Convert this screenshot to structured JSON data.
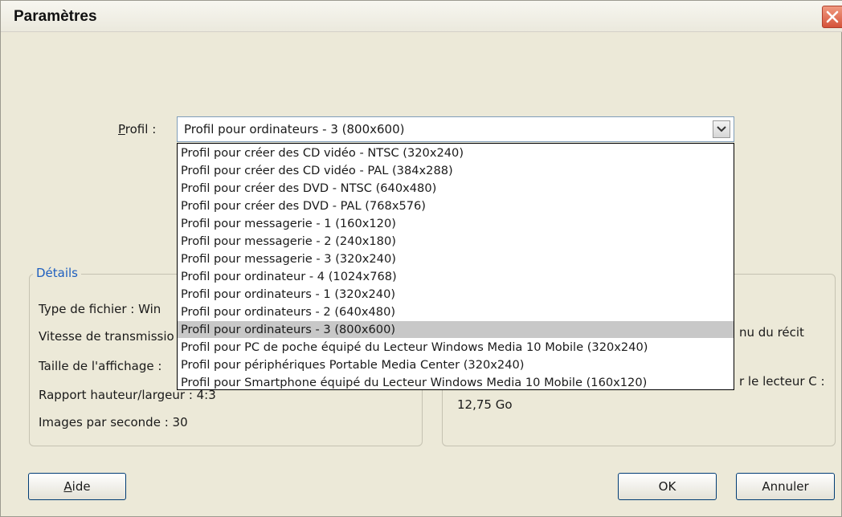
{
  "window": {
    "title": "Paramètres"
  },
  "profile": {
    "label_access_key": "P",
    "label_rest": "rofil :",
    "selected": "Profil pour ordinateurs - 3 (800x600)",
    "options": [
      "Profil pour créer des CD vidéo - NTSC (320x240)",
      "Profil pour créer des CD vidéo - PAL (384x288)",
      "Profil pour créer des DVD - NTSC (640x480)",
      "Profil pour créer des DVD - PAL (768x576)",
      "Profil pour messagerie - 1 (160x120)",
      "Profil pour messagerie - 2 (240x180)",
      "Profil pour messagerie - 3 (320x240)",
      "Profil pour ordinateur - 4 (1024x768)",
      "Profil pour ordinateurs - 1 (320x240)",
      "Profil pour ordinateurs - 2 (640x480)",
      "Profil pour ordinateurs - 3 (800x600)",
      "Profil pour PC de poche équipé du Lecteur Windows Media 10 Mobile (320x240)",
      "Profil pour périphériques Portable Media Center (320x240)",
      "Profil pour Smartphone équipé du Lecteur Windows Media 10 Mobile (160x120)"
    ],
    "highlighted_index": 10
  },
  "details": {
    "legend": "Détails",
    "type_label": "Type de fichier :  Win",
    "bitrate_label": "Vitesse de transmissio",
    "display_label": "Taille de l'affichage :",
    "aspect_label": "Rapport hauteur/largeur : 4:3",
    "fps_label": "Images par seconde :  30"
  },
  "right_panel": {
    "visible_text_1": "nu du récit",
    "visible_text_2": "r le lecteur C :",
    "free_space": "12,75 Go"
  },
  "buttons": {
    "help_access_key": "A",
    "help_rest": "ide",
    "ok": "OK",
    "cancel": "Annuler"
  },
  "colors": {
    "dialog_bg": "#ece9d8",
    "legend": "#1e5fbf",
    "selection": "#c8c8c8",
    "close_button": "#d5533a"
  }
}
